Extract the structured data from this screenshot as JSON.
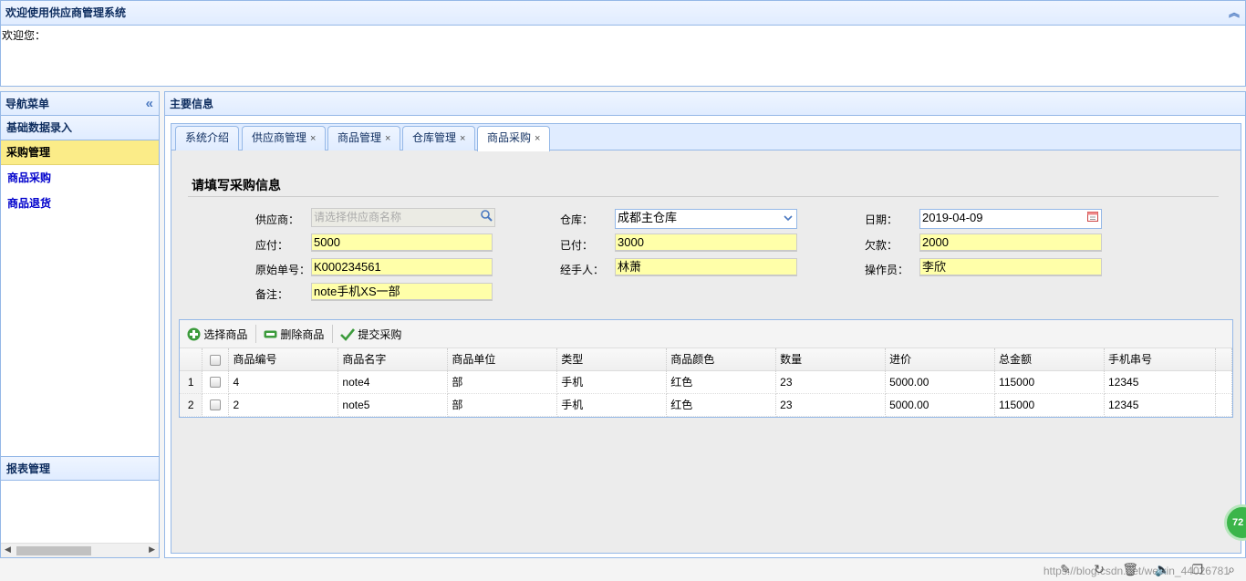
{
  "header": {
    "title": "欢迎使用供应商管理系统",
    "welcome": "欢迎您："
  },
  "nav": {
    "title": "导航菜单",
    "group_basic": "基础数据录入",
    "group_purchase": "采购管理",
    "items": [
      "商品采购",
      "商品退货"
    ],
    "group_report": "报表管理"
  },
  "main": {
    "title": "主要信息",
    "tabs": [
      {
        "label": "系统介绍",
        "closable": false
      },
      {
        "label": "供应商管理",
        "closable": true
      },
      {
        "label": "商品管理",
        "closable": true
      },
      {
        "label": "仓库管理",
        "closable": true
      },
      {
        "label": "商品采购",
        "closable": true
      }
    ],
    "close_glyph": "×"
  },
  "form": {
    "title": "请填写采购信息",
    "supplier_label": "供应商：",
    "supplier_placeholder": "请选择供应商名称",
    "warehouse_label": "仓库：",
    "warehouse_value": "成都主仓库",
    "date_label": "日期：",
    "date_value": "2019-04-09",
    "payable_label": "应付：",
    "payable_value": "5000",
    "paid_label": "已付：",
    "paid_value": "3000",
    "owed_label": "欠款：",
    "owed_value": "2000",
    "orig_no_label": "原始单号：",
    "orig_no_value": "K000234561",
    "handler_label": "经手人：",
    "handler_value": "林萧",
    "operator_label": "操作员：",
    "operator_value": "李欣",
    "note_label": "备注：",
    "note_value": "note手机XS一部"
  },
  "grid": {
    "toolbar": {
      "select": "选择商品",
      "delete": "删除商品",
      "submit": "提交采购"
    },
    "columns": [
      "商品编号",
      "商品名字",
      "商品单位",
      "类型",
      "商品颜色",
      "数量",
      "进价",
      "总金额",
      "手机串号"
    ],
    "rows": [
      {
        "rn": "1",
        "cells": [
          "4",
          "note4",
          "部",
          "手机",
          "红色",
          "23",
          "5000.00",
          "115000",
          "12345"
        ]
      },
      {
        "rn": "2",
        "cells": [
          "2",
          "note5",
          "部",
          "手机",
          "红色",
          "23",
          "5000.00",
          "115000",
          "12345"
        ]
      }
    ]
  },
  "status": {
    "watermark": "https://blog.csdn.net/weixin_44026781",
    "ball": "72"
  }
}
